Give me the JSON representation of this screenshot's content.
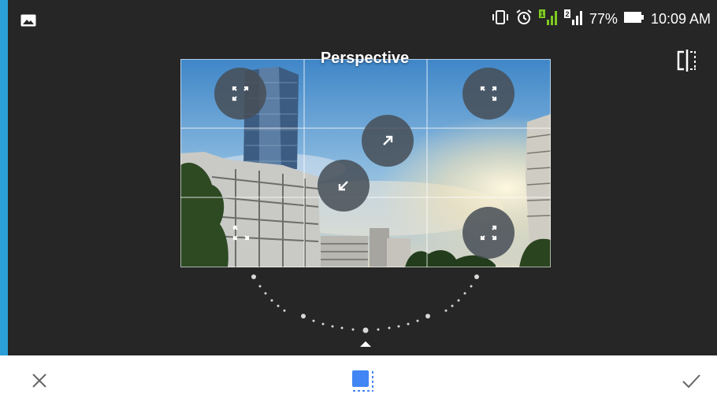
{
  "status_bar": {
    "battery_percent": "77%",
    "time": "10:09 AM",
    "icons": [
      "gallery-icon",
      "vibrate-icon",
      "alarm-icon",
      "signal-sim1-icon",
      "signal-sim2-icon",
      "battery-icon"
    ],
    "sim1_label": "1",
    "sim2_label": "2"
  },
  "editor": {
    "mode_title": "Perspective",
    "compare_icon": "compare-icon",
    "handles": [
      "expand-icon",
      "expand-icon",
      "arrow-up-right-icon",
      "arrow-down-left-icon",
      "expand-icon",
      "expand-icon"
    ]
  },
  "bottom_bar": {
    "cancel_icon": "close-icon",
    "tool_icon": "crop-transform-icon",
    "apply_icon": "checkmark-icon"
  },
  "colors": {
    "editor_background": "#262626",
    "accent_blue": "#4285f4",
    "signal_green": "#7ecb20",
    "edge_blue": "#2a9fd8"
  }
}
